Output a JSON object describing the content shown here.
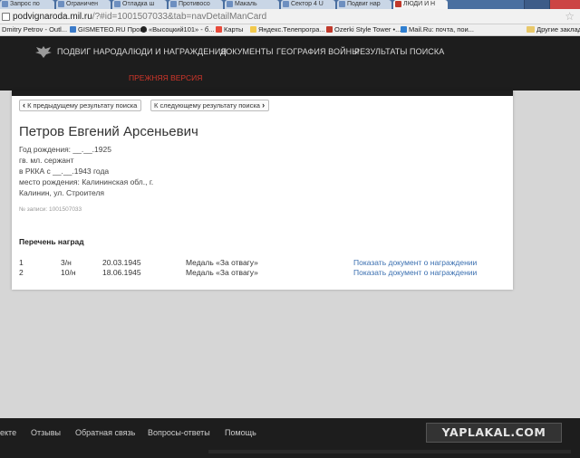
{
  "browser": {
    "tabs": [
      {
        "label": "Запрос по"
      },
      {
        "label": "Ограничен"
      },
      {
        "label": "Отладка ш"
      },
      {
        "label": "Противосо"
      },
      {
        "label": "Макаль"
      },
      {
        "label": "Сектор 4 U"
      },
      {
        "label": "Подвиг нар"
      },
      {
        "label": "ЛЮДИ И Н",
        "active": true
      }
    ],
    "url_host": "podvignaroda.mil.ru",
    "url_path": "/?#id=1001507033&tab=navDetailManCard",
    "bookmarks": [
      "Dmitry Petrov - Outl...",
      "GISMETEO.RU Прог...",
      "«Высоцкий101» - б...",
      "Карты",
      "Яндекс.Телепрогра...",
      "Ozerki Style Tower •...",
      "Mail.Ru: почта, пои..."
    ],
    "other_bookmarks": "Другие закладки"
  },
  "site": {
    "nav": [
      "ПОДВИГ НАРОДА",
      "ЛЮДИ И НАГРАЖДЕНИЯ",
      "ДОКУМЕНТЫ",
      "ГЕОГРАФИЯ ВОЙНЫ",
      "РЕЗУЛЬТАТЫ ПОИСКА"
    ],
    "legacy_link": "ПРЕЖНЯЯ ВЕРСИЯ"
  },
  "card": {
    "prev_label": "К предыдущему результату поиска",
    "next_label": "К следующему результату поиска",
    "name": "Петров Евгений Арсеньевич",
    "info_lines": [
      "Год рождения: __.__.1925",
      "гв. мл. сержант",
      "в РККА с __.__.1943 года",
      "место рождения: Калининская обл., г.",
      "Калинин, ул. Строителя"
    ],
    "record_no": "№ записи: 1001507033",
    "awards_title": "Перечень наград",
    "awards": [
      {
        "num": "1",
        "doc": "3/н",
        "date": "20.03.1945",
        "medal": "Медаль «За отвагу»",
        "link": "Показать документ о награждении"
      },
      {
        "num": "2",
        "doc": "10/н",
        "date": "18.06.1945",
        "medal": "Медаль «За отвагу»",
        "link": "Показать документ о награждении"
      }
    ]
  },
  "footer": {
    "items": [
      "екте",
      "Отзывы",
      "Обратная связь",
      "Вопросы-ответы",
      "Помощь"
    ],
    "logo": "YAPLAKAL.COM"
  }
}
